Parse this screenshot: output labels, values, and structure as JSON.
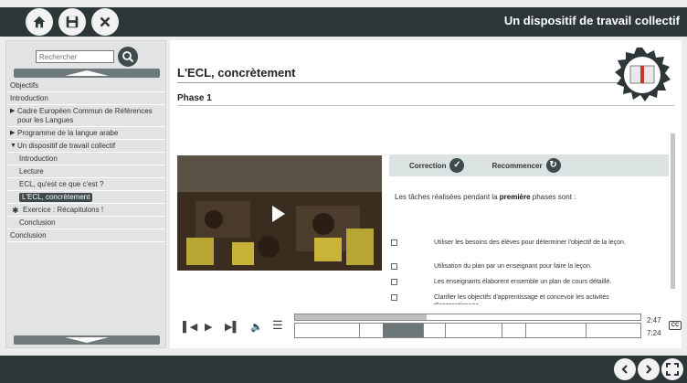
{
  "header": {
    "title": "Un dispositif de travail collectif",
    "icons": [
      "home-icon",
      "save-icon",
      "tools-icon"
    ]
  },
  "sidebar": {
    "search_placeholder": "Rechercher",
    "items": [
      {
        "label": "Objectifs",
        "level": 0
      },
      {
        "label": "Introduction",
        "level": 0
      },
      {
        "label": "Cadre Européen Commun de Références pour les Langues",
        "level": 0,
        "arrow": "right"
      },
      {
        "label": "Programme de la langue arabe",
        "level": 0,
        "arrow": "right"
      },
      {
        "label": "Un dispositif de travail collectif",
        "level": 0,
        "arrow": "down"
      },
      {
        "label": "Introduction",
        "level": 1
      },
      {
        "label": "Lecture",
        "level": 1
      },
      {
        "label": "ECL, qu'est ce que c'est ?",
        "level": 1
      },
      {
        "label": "L'ECL, concrètement",
        "level": 1,
        "selected": true
      },
      {
        "label": "Exercice : Récapitulons !",
        "level": 1,
        "icon": "quiz-icon"
      },
      {
        "label": "Conclusion",
        "level": 1
      },
      {
        "label": "Conclusion",
        "level": 0
      }
    ]
  },
  "main": {
    "title": "L'ECL, concrètement",
    "phase": "Phase 1",
    "quiz": {
      "correction_label": "Correction",
      "restart_label": "Recommencer",
      "prompt_before": "Les tâches réalisées pendant la ",
      "prompt_bold": "première",
      "prompt_after": " phases sont :",
      "options": [
        "Utiliser les besoins des élèves pour déterminer l'objectif de la leçon.",
        "Utilisation du plan par un enseignant pour faire la leçon.",
        "Les enseignants élaborent ensemble un plan de cours détaillé.",
        "Clarifier les objectifs d'apprentissage et concevoir les activités d'apprentissage."
      ]
    },
    "player": {
      "current_time": "2:47",
      "total_time": "7:24",
      "cc_label": "CC",
      "progress": 0.38
    }
  },
  "colors": {
    "bar": "#2d3738",
    "accent": "#3e4a4b",
    "quiz_header": "#dbe2e2"
  }
}
